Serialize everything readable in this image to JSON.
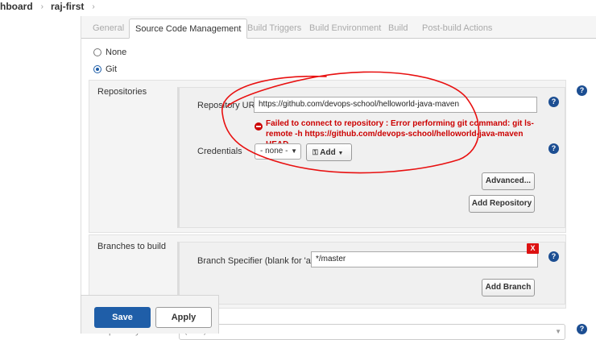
{
  "breadcrumb": [
    "hboard",
    "raj-first"
  ],
  "tabs": [
    "General",
    "Source Code Management",
    "Build Triggers",
    "Build Environment",
    "Build",
    "Post-build Actions"
  ],
  "scm": {
    "options": [
      "None",
      "Git"
    ],
    "selected": "Git"
  },
  "repositories": {
    "label": "Repositories",
    "url_label": "Repository URL",
    "url_value": "https://github.com/devops-school/helloworld-java-maven",
    "error_line1": "Failed to connect to repository : Error performing git command: git ls-",
    "error_line2": "remote -h https://github.com/devops-school/helloworld-java-maven HEAD",
    "credentials_label": "Credentials",
    "credentials_value": "- none -",
    "add_label": "Add",
    "advanced_label": "Advanced...",
    "add_repository_label": "Add Repository"
  },
  "branches": {
    "label": "Branches to build",
    "specifier_label": "Branch Specifier (blank for 'any')",
    "specifier_value": "*/master",
    "delete_label": "X",
    "add_branch_label": "Add Branch"
  },
  "repository_browser": {
    "label": "Repository browser",
    "value": "(Auto)"
  },
  "actions": {
    "save_label": "Save",
    "apply_label": "Apply"
  },
  "help_glyph": "?",
  "annotation_color": "#e81010",
  "accent_color": "#1f5ea8",
  "error_color": "#cc0000"
}
